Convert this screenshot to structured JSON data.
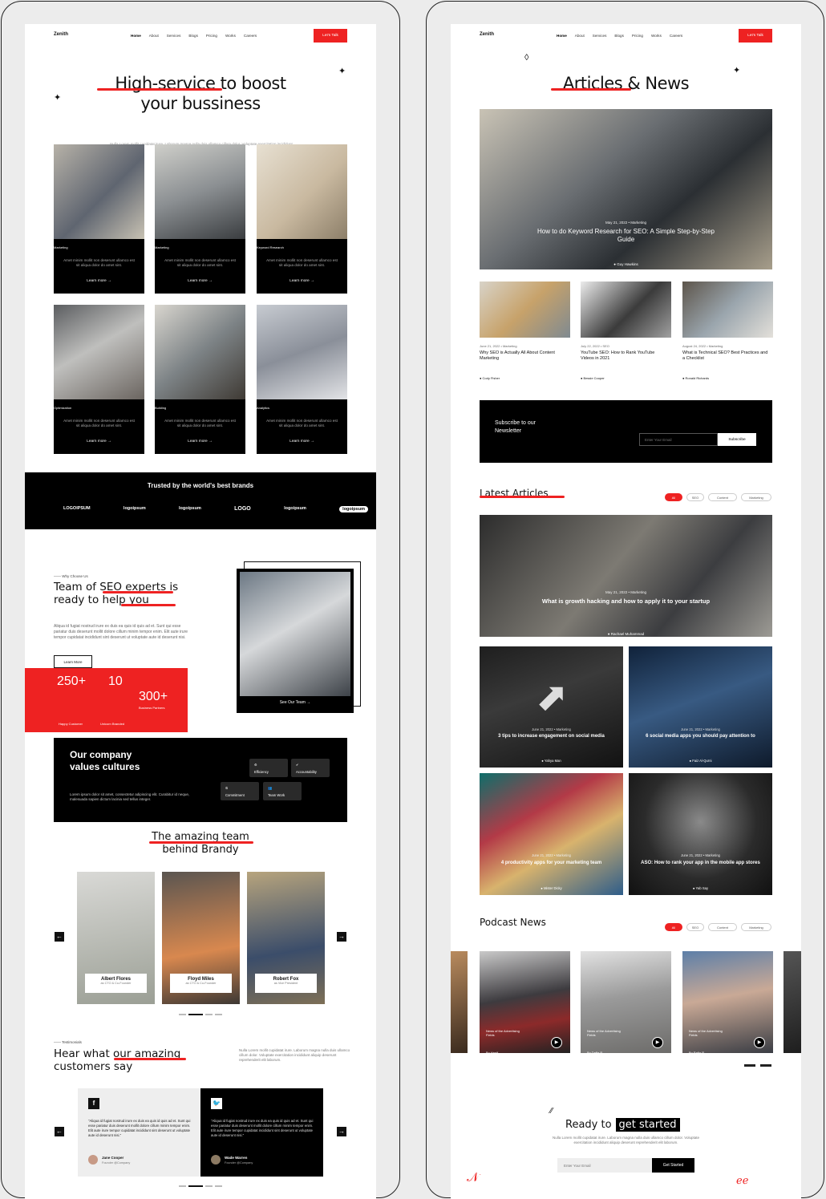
{
  "left": {
    "nav": {
      "logo": "Zenith",
      "links": [
        "Home",
        "About",
        "Services",
        "Blogs",
        "Pricing",
        "Works",
        "Careers"
      ],
      "cta": "Let's Talk"
    },
    "hero": {
      "line1a": "High-service",
      "line1b": " to boost",
      "line2": "your bussiness",
      "sub": "Nulla Lorem mollit cupidatat irure. Laborum magna nulla duis ullamco cillum dolor. Voluptate exercitation incididunt aliquip deserunt"
    },
    "services": [
      {
        "cat": "Marketing",
        "text": "Amet minim mollit non deserunt ullamco est sit aliqua dolor do amet sint.",
        "link": "Learn more"
      },
      {
        "cat": "Marketing",
        "text": "Amet minim mollit non deserunt ullamco est sit aliqua dolor do amet sint.",
        "link": "Learn more"
      },
      {
        "cat": "Keyword Research",
        "text": "Amet minim mollit non deserunt ullamco est sit aliqua dolor do amet sint.",
        "link": "Learn more"
      },
      {
        "cat": "Optimization",
        "text": "Amet minim mollit non deserunt ullamco est sit aliqua dolor do amet sint.",
        "link": "Learn more"
      },
      {
        "cat": "Building",
        "text": "Amet minim mollit non deserunt ullamco est sit aliqua dolor do amet sint.",
        "link": "Learn more"
      },
      {
        "cat": "Analytics",
        "text": "Amet minim mollit non deserunt ullamco est sit aliqua dolor do amet sint.",
        "link": "Learn more"
      }
    ],
    "brands": {
      "title": "Trusted by the world's best brands",
      "logos": [
        "LOGOIPSUM",
        "logoipsum",
        "logoipsum",
        "LOGO",
        "logoipsum",
        "logoipsum"
      ]
    },
    "why": {
      "eyebrow": "Why Choose Us",
      "t1a": "Team of ",
      "t1b": "SEO experts",
      "t1c": " is",
      "t2": "ready to help you",
      "body": "Aliqua id fugiat nostrud irure ex duis ea quis id quis ad et. Sunt qui esse pariatur duis deserunt mollit dolore cillum minim tempor enim. Elit aute irure tempor cupidatat incididunt sint deserunt ut voluptate aute id deserunt nisi.",
      "btn": "Learn More",
      "stat1": "250+",
      "stat1l": "Happy Customer",
      "stat2": "10",
      "stat2l": "Unicorn Branded",
      "stat3": "300+",
      "stat3l": "Business Partners",
      "team_link": "See Our Team"
    },
    "values": {
      "t1": "Our company",
      "t2": "values cultures",
      "body": "Lorem ipsum dolor sit amet, consectetur adipiscing elit. Curabitur id neque, malesuada sapien dictum lacinia sed tellus integer.",
      "items": [
        "Efficiency",
        "Accountability",
        "Commitment",
        "Team Work"
      ]
    },
    "team": {
      "t1": "The amazing team",
      "t2": "behind Brandy",
      "members": [
        {
          "name": "Albert Flores",
          "role": "as CTO & Co-Founder"
        },
        {
          "name": "Floyd Miles",
          "role": "as CTO & Co-Founder"
        },
        {
          "name": "Robert Fox",
          "role": "as Vice President"
        }
      ]
    },
    "testimonials": {
      "eyebrow": "Testimonials",
      "t1a": "Hear what ",
      "t1b": "our amazing",
      "t2": "customers say",
      "sub": "Nulla Lorem mollit cupidatat irure. Laborum magna nulla duis ullamco cillum dolor. Voluptate exercitation incididunt aliquip deserunt reprehenderit elit laborum.",
      "items": [
        {
          "quote": "\"Aliqua id fugiat nostrud irure ex duis ea quis id quis ad et. Sunt qui esse pariatur duis deserunt mollit dolore cillum minim tempor enim. Elit aute irure tempor cupidatat incididunt sint deserunt ut voluptate aute id deserunt nisi.\"",
          "name": "Jane Cooper",
          "role": "Founder @Company"
        },
        {
          "quote": "\"Aliqua id fugiat nostrud irure ex duis ea quis id quis ad et. Sunt qui esse pariatur duis deserunt mollit dolore cillum minim tempor enim. Elit aute irure tempor cupidatat incididunt sint deserunt ut voluptate aute id deserunt nisi.\"",
          "name": "Wade Warren",
          "role": "Founder @Company"
        }
      ]
    }
  },
  "right": {
    "nav": {
      "logo": "Zenith",
      "links": [
        "Home",
        "About",
        "Services",
        "Blogs",
        "Pricing",
        "Works",
        "Careers"
      ],
      "cta": "Let's Talk"
    },
    "title_a": "Articles",
    "title_b": " & News",
    "featured": {
      "meta": "May 21, 2022 • Marketing",
      "title": "How to do Keyword Research for SEO: A Simple Step-by-Step Guide",
      "author": "Guy Hawkins"
    },
    "small": [
      {
        "meta": "June 21, 2022 • Marketing",
        "title": "Why SEO is Actually All About Content Marketing",
        "author": "Cody Fisher"
      },
      {
        "meta": "July 22, 2022 • SEO",
        "title": "YouTube SEO: How to Rank YouTube Videos in 2021",
        "author": "Bessie Cooper"
      },
      {
        "meta": "August 24, 2022 • Marketing",
        "title": "What is Technical SEO? Best Practices and a Checklist",
        "author": "Ronald Richards"
      }
    ],
    "newsletter": {
      "t1": "Subscribe to our",
      "t2": "Newsletter",
      "placeholder": "Enter Your Email",
      "btn": "Subscribe"
    },
    "latest": {
      "title": "Latest Articles",
      "filters": [
        "All",
        "SEO",
        "Content",
        "Marketing"
      ],
      "big": {
        "meta": "May 21, 2022 • Marketing",
        "title": "What is growth hacking and how to apply it to your startup",
        "author": "Rachael Muhammad"
      },
      "grid": [
        {
          "meta": "June 21, 2022 • Marketing",
          "title": "3 tips to increase engagement on social media",
          "author": "Yahya Man"
        },
        {
          "meta": "June 21, 2022 • Marketing",
          "title": "6 social media apps you should pay attention to",
          "author": "Faiz Al-Qurni"
        },
        {
          "meta": "June 21, 2022 • Marketing",
          "title": "4 productivity apps for your marketing team",
          "author": "Mister Dicky"
        },
        {
          "meta": "June 21, 2022 • Marketing",
          "title": "ASO: How to rank your app in the mobile app stores",
          "author": "Yab Say"
        }
      ]
    },
    "podcast": {
      "title": "Podcast News",
      "filters": [
        "All",
        "SEO",
        "Content",
        "Marketing"
      ],
      "cards": [
        {
          "t": "News of the Advertising Fields",
          "a": "By Hanif"
        },
        {
          "t": "News of the Advertising Fields",
          "a": "By Daffa R."
        },
        {
          "t": "News of the Advertising Fields",
          "a": "By Rafiq R."
        }
      ]
    },
    "cta": {
      "a": "Ready to",
      "b": "get started",
      "sub": "Nulla Lorem mollit cupidatat irure. Laborum magna nulla duis ullamco cillum dolor. Voluptate exercitation incididunt aliquip deserunt reprehenderit elit laborum.",
      "placeholder": "Enter Your Email",
      "btn": "Get Started"
    }
  }
}
